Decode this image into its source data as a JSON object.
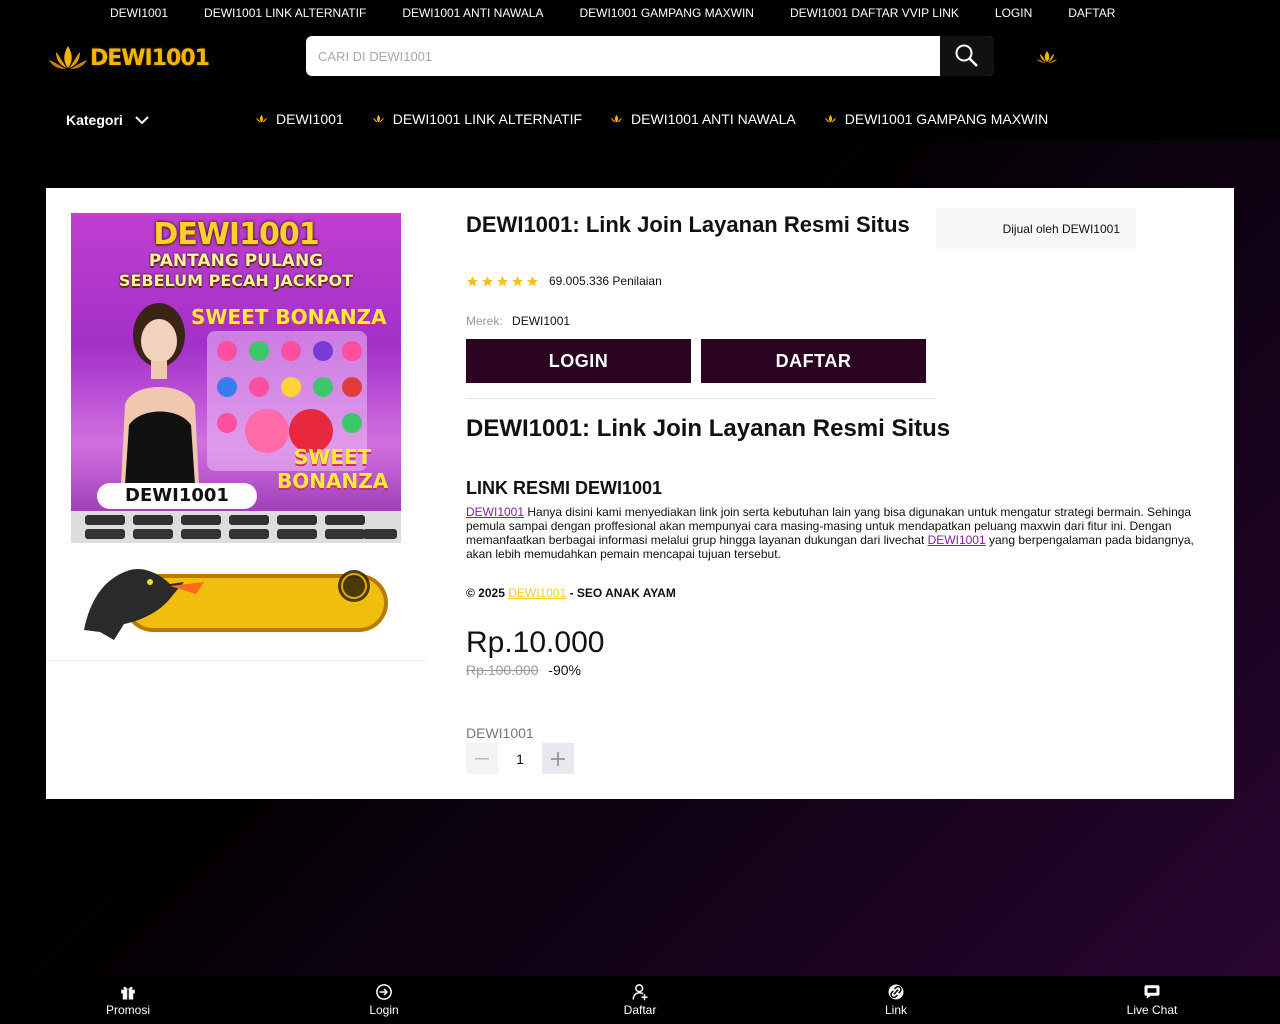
{
  "top_links": [
    "DEWI1001",
    "DEWI1001 LINK ALTERNATIF",
    "DEWI1001 ANTI NAWALA",
    "DEWI1001 GAMPANG MAXWIN",
    "DEWI1001 DAFTAR VVIP LINK",
    "LOGIN",
    "DAFTAR"
  ],
  "logo_text": "DEWI1001",
  "search": {
    "placeholder": "CARI DI DEWI1001"
  },
  "kategori_label": "Kategori",
  "category_nav": [
    "DEWI1001",
    "DEWI1001 LINK ALTERNATIF",
    "DEWI1001 ANTI NAWALA",
    "DEWI1001 GAMPANG MAXWIN"
  ],
  "banner": {
    "title": "DEWI1001",
    "subtitle1": "PANTANG PULANG",
    "subtitle2": "SEBELUM PECAH JACKPOT",
    "game1": "SWEET BONANZA",
    "game2a": "SWEET",
    "game2b": "BONANZA",
    "label": "DEWI1001"
  },
  "product": {
    "title": "DEWI1001: Link Join Layanan Resmi Situs",
    "rating_stars": 5,
    "rating_text": "69.005.336 Penilaian",
    "brand_key": "Merek:",
    "brand_value": "DEWI1001",
    "login_label": "LOGIN",
    "daftar_label": "DAFTAR",
    "seller": "Dijual oleh DEWI1001",
    "price": "Rp.10.000",
    "old_price": "Rp.100.000",
    "discount": "-90%",
    "variant": "DEWI1001",
    "quantity": "1"
  },
  "description": {
    "heading": "DEWI1001: Link Join Layanan Resmi Situs",
    "subheading": "LINK RESMI DEWI1001",
    "link1": "DEWI1001",
    "text1": " Hanya disini kami menyediakan link join serta kebutuhan lain yang bisa digunakan untuk mengatur strategi bermain. Sehinga pemula sampai dengan proffesional akan mempunyai cara masing-masing untuk mendapatkan peluang maxwin dari fitur ini. Dengan memanfaatkan berbagai informasi melalui grup hingga layanan dukungan dari livechat ",
    "link2": "DEWI1001",
    "text2": " yang berpengalaman pada bidangnya, akan lebih memudahkan pemain mencapai tujuan tersebut.",
    "copy_prefix": "© 2025 ",
    "copy_link": "DEWI1001",
    "copy_suffix": " - SEO ANAK AYAM"
  },
  "bottom_nav": [
    {
      "label": "Promosi",
      "icon": "gift-icon"
    },
    {
      "label": "Login",
      "icon": "login-icon"
    },
    {
      "label": "Daftar",
      "icon": "user-add-icon"
    },
    {
      "label": "Link",
      "icon": "link-icon"
    },
    {
      "label": "Live Chat",
      "icon": "chat-icon"
    }
  ],
  "colors": {
    "button_bg": "#2a0420",
    "link": "#8a1aa8",
    "copy_link": "#f4d01b",
    "logo_gold": "#f2b600"
  }
}
